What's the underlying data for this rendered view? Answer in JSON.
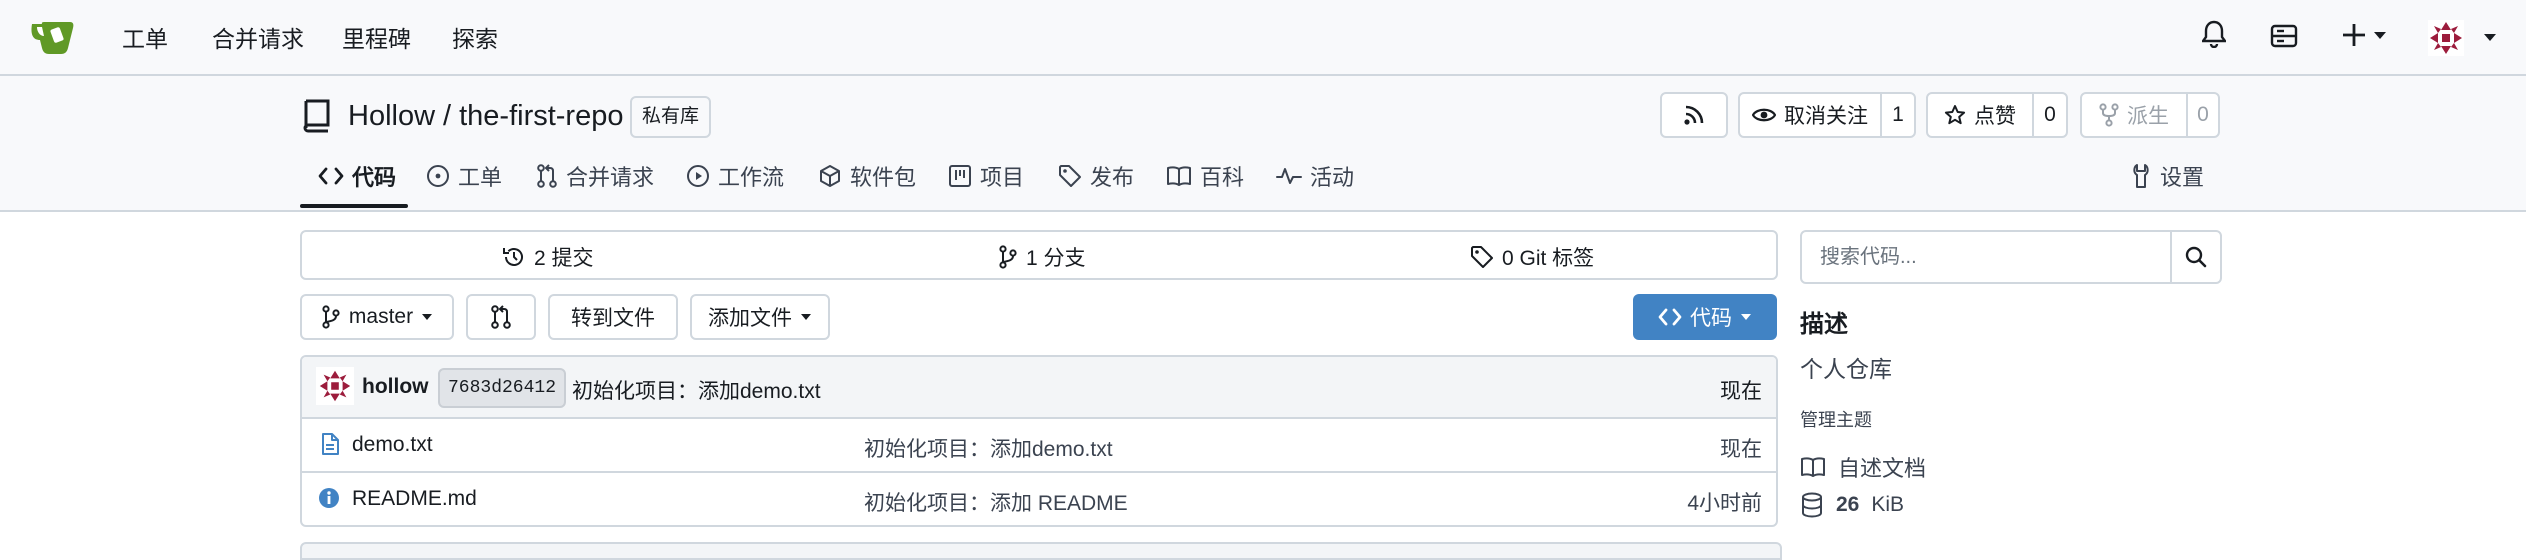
{
  "nav": {
    "items": [
      "工单",
      "合并请求",
      "里程碑",
      "探索"
    ]
  },
  "repo": {
    "owner": "Hollow",
    "separator": "/",
    "name": "the-first-repo",
    "visibility": "私有库",
    "unwatch_label": "取消关注",
    "watch_count": "1",
    "star_label": "点赞",
    "star_count": "0",
    "fork_label": "派生",
    "fork_count": "0"
  },
  "tabs": [
    "代码",
    "工单",
    "合并请求",
    "工作流",
    "软件包",
    "项目",
    "发布",
    "百科",
    "活动"
  ],
  "settings_label": "设置",
  "summary": {
    "commits": "2 提交",
    "branches": "1 分支",
    "tags": "0 Git 标签"
  },
  "toolbar": {
    "branch": "master",
    "goto_file": "转到文件",
    "add_file": "添加文件",
    "code": "代码"
  },
  "latest_commit": {
    "author": "hollow",
    "sha": "7683d26412",
    "message": "初始化项目：添加demo.txt",
    "time": "现在"
  },
  "files": [
    {
      "name": "demo.txt",
      "icon": "file-icon",
      "message": "初始化项目：添加demo.txt",
      "time": "现在"
    },
    {
      "name": "README.md",
      "icon": "info-icon",
      "message": "初始化项目：添加 README",
      "time": "4小时前"
    }
  ],
  "sidebar": {
    "search_placeholder": "搜索代码...",
    "description_title": "描述",
    "description": "个人仓库",
    "topics_label": "管理主题",
    "readme_label": "自述文档",
    "size_value": "26",
    "size_unit": "KiB"
  },
  "colors": {
    "accent": "#4183c4",
    "logo": "#609926",
    "nav_bg": "#f8f9fb",
    "border": "#d0d7de"
  }
}
